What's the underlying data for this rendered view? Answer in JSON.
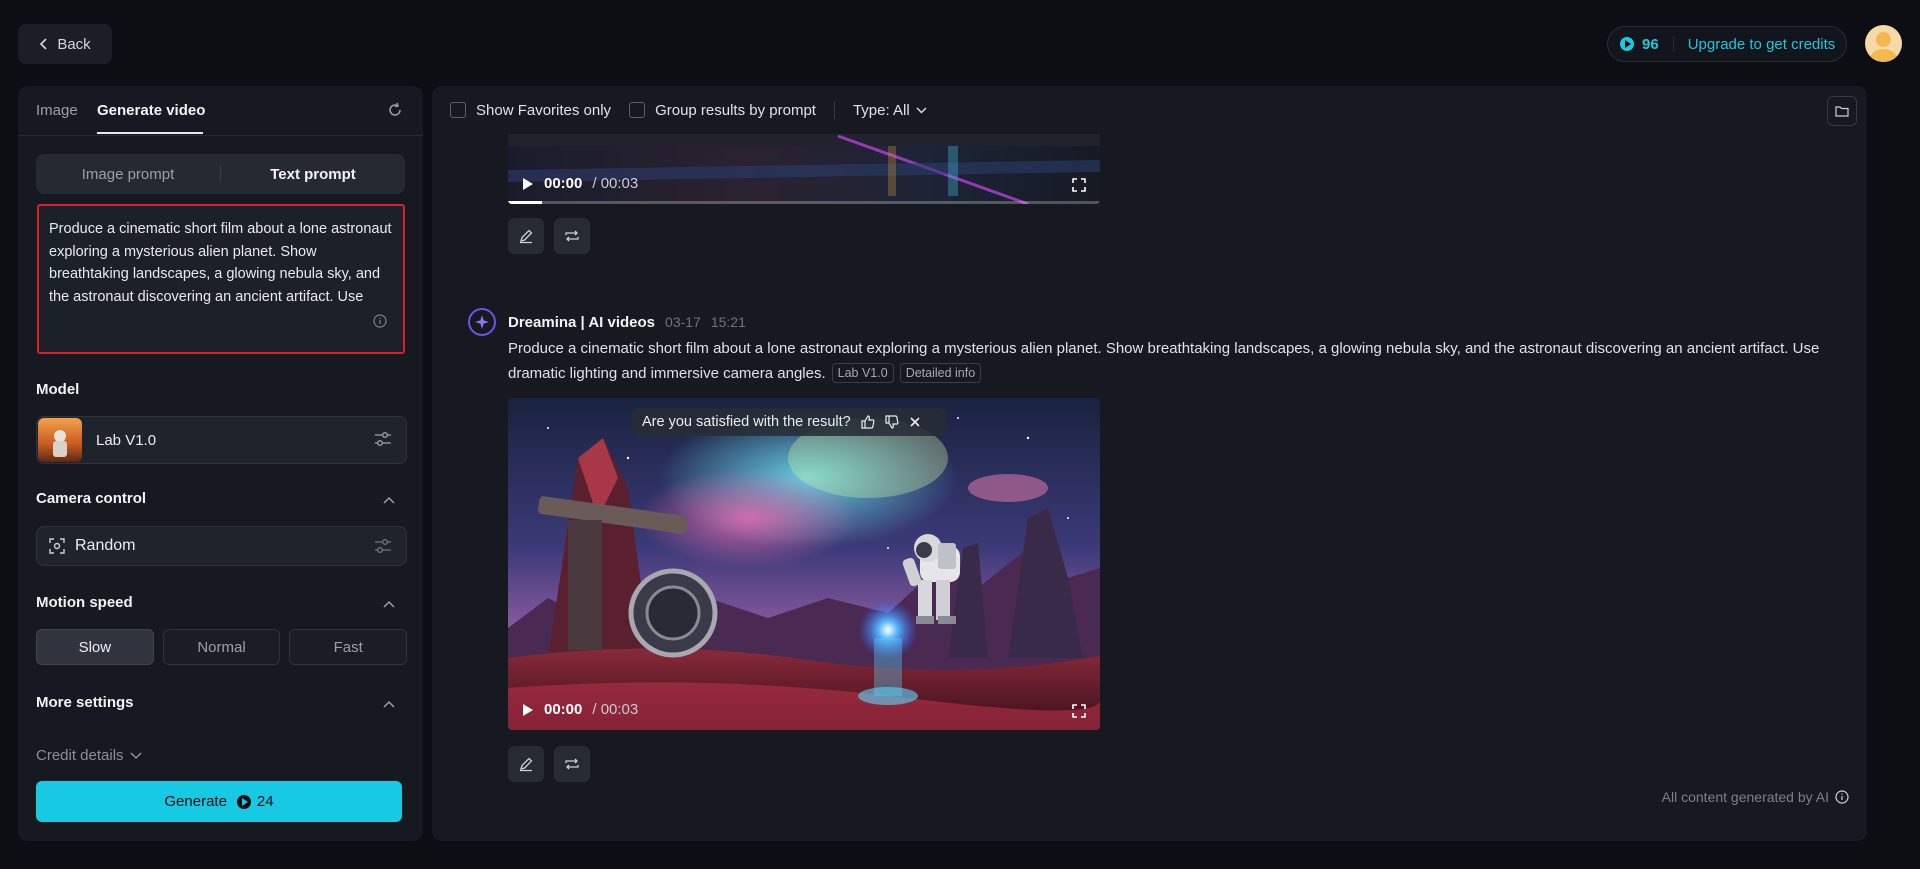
{
  "topbar": {
    "back_label": "Back",
    "credits": "96",
    "upgrade_label": "Upgrade to get credits"
  },
  "left": {
    "tabs": [
      {
        "label": "Image"
      },
      {
        "label": "Generate video"
      }
    ],
    "prompt_modes": [
      {
        "label": "Image prompt"
      },
      {
        "label": "Text prompt"
      }
    ],
    "prompt_text": "Produce a cinematic short film about a lone astronaut exploring a mysterious alien planet. Show breathtaking landscapes, a glowing nebula sky, and the astronaut discovering an ancient artifact. Use dramatic lighting and immersive camera angles.",
    "model": {
      "title": "Model",
      "name": "Lab V1.0"
    },
    "camera": {
      "title": "Camera control",
      "value": "Random"
    },
    "motion": {
      "title": "Motion speed",
      "options": [
        "Slow",
        "Normal",
        "Fast"
      ],
      "selected": "Slow"
    },
    "more_settings": "More settings",
    "credit_details": "Credit details",
    "generate": {
      "label": "Generate",
      "cost": "24"
    }
  },
  "main": {
    "filters": {
      "favorites": "Show Favorites only",
      "group": "Group results by prompt",
      "type": "Type: All"
    },
    "video_top": {
      "time": "00:00",
      "duration": "/ 00:03"
    },
    "message": {
      "author": "Dreamina | AI videos",
      "date": "03-17",
      "time": "15:21",
      "text": "Produce a cinematic short film about a lone astronaut exploring a mysterious alien planet. Show breathtaking landscapes, a glowing nebula sky, and the astronaut discovering an ancient artifact. Use dramatic lighting and immersive camera angles.",
      "tags": [
        "Lab V1.0",
        "Detailed info"
      ]
    },
    "feedback_question": "Are you satisfied with the result?",
    "video_main": {
      "time": "00:00",
      "duration": "/ 00:03"
    },
    "ai_note": "All content generated by AI"
  },
  "colors": {
    "accent": "#17c9e2",
    "highlight_border": "#d81f2a",
    "panel_bg": "#16191f",
    "page_bg": "#0c0e13"
  }
}
